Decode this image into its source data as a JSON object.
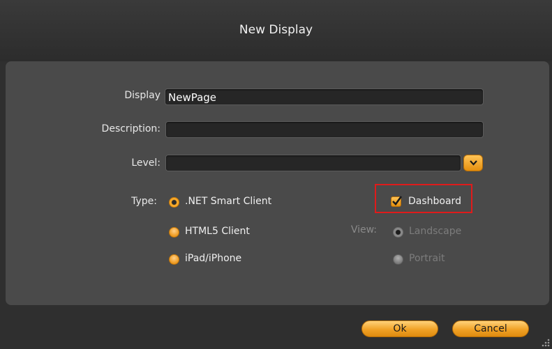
{
  "dialog": {
    "title": "New Display"
  },
  "form": {
    "display_label": "Display",
    "display_value": "NewPage",
    "description_label": "Description:",
    "description_value": "",
    "level_label": "Level:",
    "level_value": "",
    "type_label": "Type:",
    "type_options": [
      {
        "label": ".NET Smart Client",
        "selected": true
      },
      {
        "label": "HTML5 Client",
        "selected": false
      },
      {
        "label": "iPad/iPhone",
        "selected": false
      }
    ],
    "dashboard_label": "Dashboard",
    "dashboard_checked": true,
    "view_label": "View:",
    "view_options": [
      {
        "label": "Landscape",
        "selected": true,
        "enabled": false
      },
      {
        "label": "Portrait",
        "selected": false,
        "enabled": false
      }
    ]
  },
  "buttons": {
    "ok_label": "Ok",
    "cancel_label": "Cancel"
  },
  "colors": {
    "accent": "#f0a02b",
    "highlight": "#e01b1b",
    "panel": "#4a4a4a"
  },
  "icons": {
    "dropdown": "chevron-down-icon",
    "check": "check-icon",
    "resize": "resize-grip-icon"
  }
}
